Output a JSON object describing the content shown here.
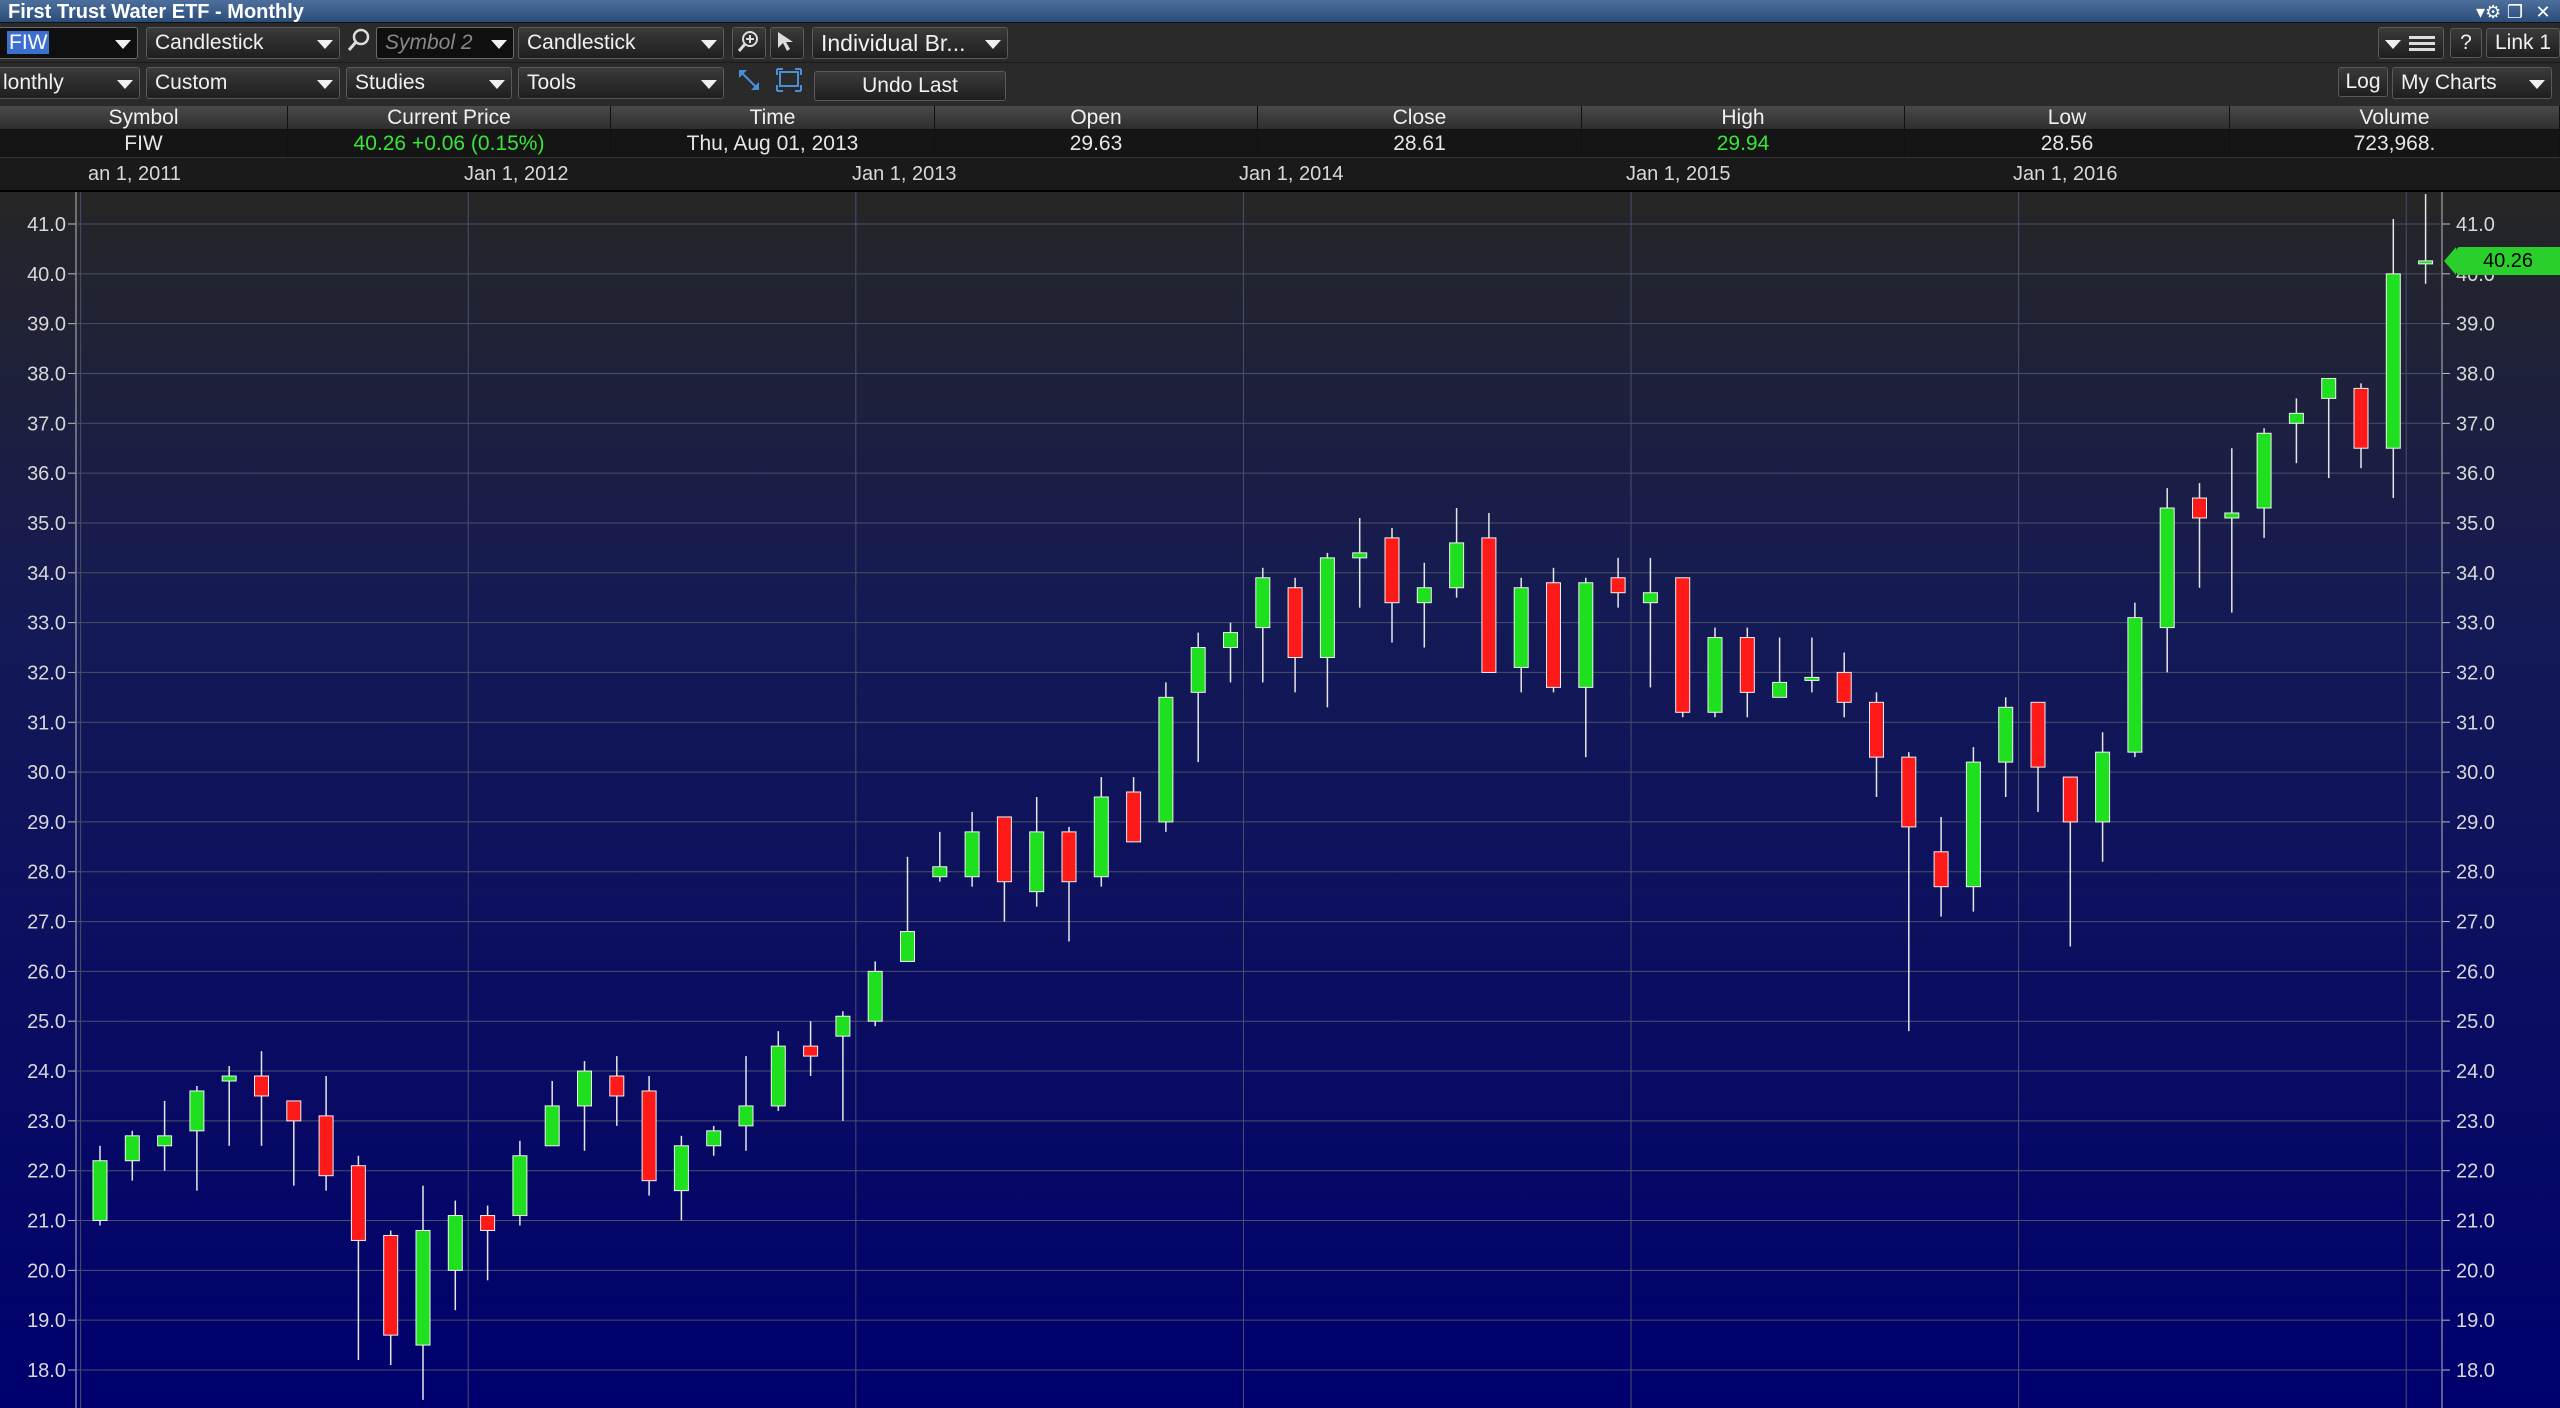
{
  "window": {
    "title": "First Trust Water ETF - Monthly",
    "controls": [
      "▾⚙",
      "❐",
      "✕"
    ]
  },
  "toolbar1": {
    "symbol_value": "FIW",
    "chart_type_1": "Candlestick",
    "symbol2_placeholder": "Symbol 2",
    "chart_type_2": "Candlestick",
    "account_select": "Individual Br...",
    "help_label": "?",
    "link_label": "Link 1"
  },
  "toolbar2": {
    "period_select": "lonthly",
    "range_select": "Custom",
    "studies_select": "Studies",
    "tools_select": "Tools",
    "undo_label": "Undo Last",
    "log_label": "Log",
    "mycharts_label": "My Charts"
  },
  "quote": {
    "headers": [
      "Symbol",
      "Current Price",
      "Time",
      "Open",
      "Close",
      "High",
      "Low",
      "Volume"
    ],
    "symbol": "FIW",
    "current_price": "40.26  +0.06 (0.15%)",
    "time": "Thu, Aug 01, 2013",
    "open": "29.63",
    "close": "28.61",
    "high": "29.94",
    "low": "28.56",
    "volume": "723,968."
  },
  "date_labels": [
    "an 1, 2011",
    "Jan 1, 2012",
    "Jan 1, 2013",
    "Jan 1, 2014",
    "Jan 1, 2015",
    "Jan 1, 2016"
  ],
  "last_price_badge": "40.26",
  "colors": {
    "up": "#1fe01f",
    "down": "#ff1a1a",
    "bg_top": "#262626",
    "bg_bottom": "#00006e",
    "grid": "#4a4f6a",
    "accent_green": "#39e539"
  },
  "chart_data": {
    "type": "candlestick",
    "title": "First Trust Water ETF - Monthly",
    "x_tick_labels": [
      "an 1, 2011",
      "Jan 1, 2012",
      "Jan 1, 2013",
      "Jan 1, 2014",
      "Jan 1, 2015",
      "Jan 1, 2016"
    ],
    "y_tick_labels": [
      "41.0",
      "40.0",
      "39.0",
      "38.0",
      "37.0",
      "36.0",
      "35.0",
      "34.0",
      "33.0",
      "32.0",
      "31.0",
      "30.0",
      "29.0",
      "28.0",
      "27.0",
      "26.0",
      "25.0",
      "24.0",
      "23.0",
      "22.0",
      "21.0",
      "20.0",
      "19.0",
      "18.0"
    ],
    "ylim": [
      17.4,
      41.6
    ],
    "grid": true,
    "start_month": "Jan 2011",
    "candles": [
      {
        "o": 21.0,
        "h": 22.5,
        "l": 20.9,
        "c": 22.2
      },
      {
        "o": 22.2,
        "h": 22.8,
        "l": 21.8,
        "c": 22.7
      },
      {
        "o": 22.5,
        "h": 23.4,
        "l": 22.0,
        "c": 22.7
      },
      {
        "o": 22.8,
        "h": 23.7,
        "l": 21.6,
        "c": 23.6
      },
      {
        "o": 23.8,
        "h": 24.1,
        "l": 22.5,
        "c": 23.9
      },
      {
        "o": 23.9,
        "h": 24.4,
        "l": 22.5,
        "c": 23.5
      },
      {
        "o": 23.4,
        "h": 23.4,
        "l": 21.7,
        "c": 23.0
      },
      {
        "o": 23.1,
        "h": 23.9,
        "l": 21.6,
        "c": 21.9
      },
      {
        "o": 22.1,
        "h": 22.3,
        "l": 18.2,
        "c": 20.6
      },
      {
        "o": 20.7,
        "h": 20.8,
        "l": 18.1,
        "c": 18.7
      },
      {
        "o": 18.5,
        "h": 21.7,
        "l": 17.4,
        "c": 20.8
      },
      {
        "o": 20.0,
        "h": 21.4,
        "l": 19.2,
        "c": 21.1
      },
      {
        "o": 21.1,
        "h": 21.3,
        "l": 19.8,
        "c": 20.8
      },
      {
        "o": 21.1,
        "h": 22.6,
        "l": 20.9,
        "c": 22.3
      },
      {
        "o": 22.5,
        "h": 23.8,
        "l": 22.5,
        "c": 23.3
      },
      {
        "o": 23.3,
        "h": 24.2,
        "l": 22.4,
        "c": 24.0
      },
      {
        "o": 23.9,
        "h": 24.3,
        "l": 22.9,
        "c": 23.5
      },
      {
        "o": 23.6,
        "h": 23.9,
        "l": 21.5,
        "c": 21.8
      },
      {
        "o": 21.6,
        "h": 22.7,
        "l": 21.0,
        "c": 22.5
      },
      {
        "o": 22.5,
        "h": 22.9,
        "l": 22.3,
        "c": 22.8
      },
      {
        "o": 22.9,
        "h": 24.3,
        "l": 22.4,
        "c": 23.3
      },
      {
        "o": 23.3,
        "h": 24.8,
        "l": 23.2,
        "c": 24.5
      },
      {
        "o": 24.5,
        "h": 25.0,
        "l": 23.9,
        "c": 24.3
      },
      {
        "o": 24.7,
        "h": 25.2,
        "l": 23.0,
        "c": 25.1
      },
      {
        "o": 25.0,
        "h": 26.2,
        "l": 24.9,
        "c": 26.0
      },
      {
        "o": 26.2,
        "h": 28.3,
        "l": 26.5,
        "c": 26.8
      },
      {
        "o": 27.9,
        "h": 28.8,
        "l": 27.8,
        "c": 28.1
      },
      {
        "o": 27.9,
        "h": 29.2,
        "l": 27.7,
        "c": 28.8
      },
      {
        "o": 29.1,
        "h": 29.1,
        "l": 27.0,
        "c": 27.8
      },
      {
        "o": 27.6,
        "h": 29.5,
        "l": 27.3,
        "c": 28.8
      },
      {
        "o": 28.8,
        "h": 28.9,
        "l": 26.6,
        "c": 27.8
      },
      {
        "o": 27.9,
        "h": 29.9,
        "l": 27.7,
        "c": 29.5
      },
      {
        "o": 29.6,
        "h": 29.9,
        "l": 28.6,
        "c": 28.6
      },
      {
        "o": 29.0,
        "h": 31.8,
        "l": 28.8,
        "c": 31.5
      },
      {
        "o": 31.6,
        "h": 32.8,
        "l": 30.2,
        "c": 32.5
      },
      {
        "o": 32.5,
        "h": 33.0,
        "l": 31.8,
        "c": 32.8
      },
      {
        "o": 32.9,
        "h": 34.1,
        "l": 31.8,
        "c": 33.9
      },
      {
        "o": 33.7,
        "h": 33.9,
        "l": 31.6,
        "c": 32.3
      },
      {
        "o": 32.3,
        "h": 34.4,
        "l": 31.3,
        "c": 34.3
      },
      {
        "o": 34.3,
        "h": 35.1,
        "l": 33.3,
        "c": 34.4
      },
      {
        "o": 34.7,
        "h": 34.9,
        "l": 32.6,
        "c": 33.4
      },
      {
        "o": 33.4,
        "h": 34.2,
        "l": 32.5,
        "c": 33.7
      },
      {
        "o": 33.7,
        "h": 35.3,
        "l": 33.5,
        "c": 34.6
      },
      {
        "o": 34.7,
        "h": 35.2,
        "l": 32.0,
        "c": 32.0
      },
      {
        "o": 32.1,
        "h": 33.9,
        "l": 31.6,
        "c": 33.7
      },
      {
        "o": 33.8,
        "h": 34.1,
        "l": 31.6,
        "c": 31.7
      },
      {
        "o": 31.7,
        "h": 33.9,
        "l": 30.3,
        "c": 33.8
      },
      {
        "o": 33.9,
        "h": 34.3,
        "l": 33.3,
        "c": 33.6
      },
      {
        "o": 33.4,
        "h": 34.3,
        "l": 31.7,
        "c": 33.6
      },
      {
        "o": 33.9,
        "h": 33.9,
        "l": 31.1,
        "c": 31.2
      },
      {
        "o": 31.2,
        "h": 32.9,
        "l": 31.1,
        "c": 32.7
      },
      {
        "o": 32.7,
        "h": 32.9,
        "l": 31.1,
        "c": 31.6
      },
      {
        "o": 31.5,
        "h": 32.7,
        "l": 31.5,
        "c": 31.8
      },
      {
        "o": 31.9,
        "h": 32.7,
        "l": 31.6,
        "c": 31.9
      },
      {
        "o": 32.0,
        "h": 32.4,
        "l": 31.1,
        "c": 31.4
      },
      {
        "o": 31.4,
        "h": 31.6,
        "l": 29.5,
        "c": 30.3
      },
      {
        "o": 30.3,
        "h": 30.4,
        "l": 24.8,
        "c": 28.9
      },
      {
        "o": 28.4,
        "h": 29.1,
        "l": 27.1,
        "c": 27.7
      },
      {
        "o": 27.7,
        "h": 30.5,
        "l": 27.2,
        "c": 30.2
      },
      {
        "o": 30.2,
        "h": 31.5,
        "l": 29.5,
        "c": 31.3
      },
      {
        "o": 31.4,
        "h": 31.4,
        "l": 29.2,
        "c": 30.1
      },
      {
        "o": 29.9,
        "h": 29.9,
        "l": 26.5,
        "c": 29.0
      },
      {
        "o": 29.0,
        "h": 30.8,
        "l": 28.2,
        "c": 30.4
      },
      {
        "o": 30.4,
        "h": 33.4,
        "l": 30.3,
        "c": 33.1
      },
      {
        "o": 32.9,
        "h": 35.7,
        "l": 32.0,
        "c": 35.3
      },
      {
        "o": 35.5,
        "h": 35.8,
        "l": 33.7,
        "c": 35.1
      },
      {
        "o": 35.1,
        "h": 36.5,
        "l": 33.2,
        "c": 35.2
      },
      {
        "o": 35.3,
        "h": 36.9,
        "l": 34.7,
        "c": 36.8
      },
      {
        "o": 37.0,
        "h": 37.5,
        "l": 36.2,
        "c": 37.2
      },
      {
        "o": 37.5,
        "h": 37.9,
        "l": 35.9,
        "c": 37.9
      },
      {
        "o": 37.7,
        "h": 37.8,
        "l": 36.1,
        "c": 36.5
      },
      {
        "o": 36.5,
        "h": 41.1,
        "l": 35.5,
        "c": 40.0
      },
      {
        "o": 40.2,
        "h": 41.6,
        "l": 39.8,
        "c": 40.26
      }
    ]
  }
}
